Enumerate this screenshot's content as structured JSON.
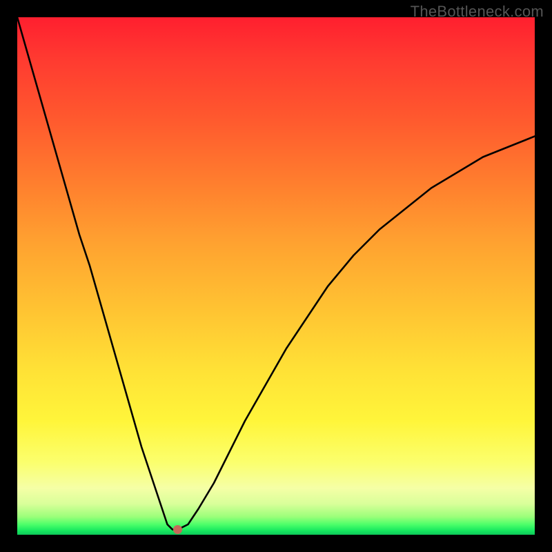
{
  "watermark": "TheBottleneck.com",
  "chart_data": {
    "type": "line",
    "title": "",
    "xlabel": "",
    "ylabel": "",
    "xlim": [
      0,
      100
    ],
    "ylim": [
      0,
      100
    ],
    "grid": false,
    "legend": false,
    "series": [
      {
        "name": "bottleneck-curve",
        "x": [
          0,
          2,
          4,
          6,
          8,
          10,
          12,
          14,
          16,
          18,
          20,
          22,
          24,
          26,
          28,
          29,
          30,
          31,
          33,
          35,
          38,
          41,
          44,
          48,
          52,
          56,
          60,
          65,
          70,
          75,
          80,
          85,
          90,
          95,
          100
        ],
        "y": [
          100,
          93,
          86,
          79,
          72,
          65,
          58,
          52,
          45,
          38,
          31,
          24,
          17,
          11,
          5,
          2,
          1,
          1,
          2,
          5,
          10,
          16,
          22,
          29,
          36,
          42,
          48,
          54,
          59,
          63,
          67,
          70,
          73,
          75,
          77
        ]
      }
    ],
    "marker": {
      "x": 31,
      "y": 1,
      "name": "optimal-point"
    },
    "background_gradient": {
      "direction": "top-to-bottom",
      "stops": [
        {
          "pos": 0.0,
          "color": "#ff1f2f"
        },
        {
          "pos": 0.32,
          "color": "#ff7e2e"
        },
        {
          "pos": 0.68,
          "color": "#ffe136"
        },
        {
          "pos": 0.91,
          "color": "#f5ffa6"
        },
        {
          "pos": 1.0,
          "color": "#0dc85a"
        }
      ]
    }
  }
}
